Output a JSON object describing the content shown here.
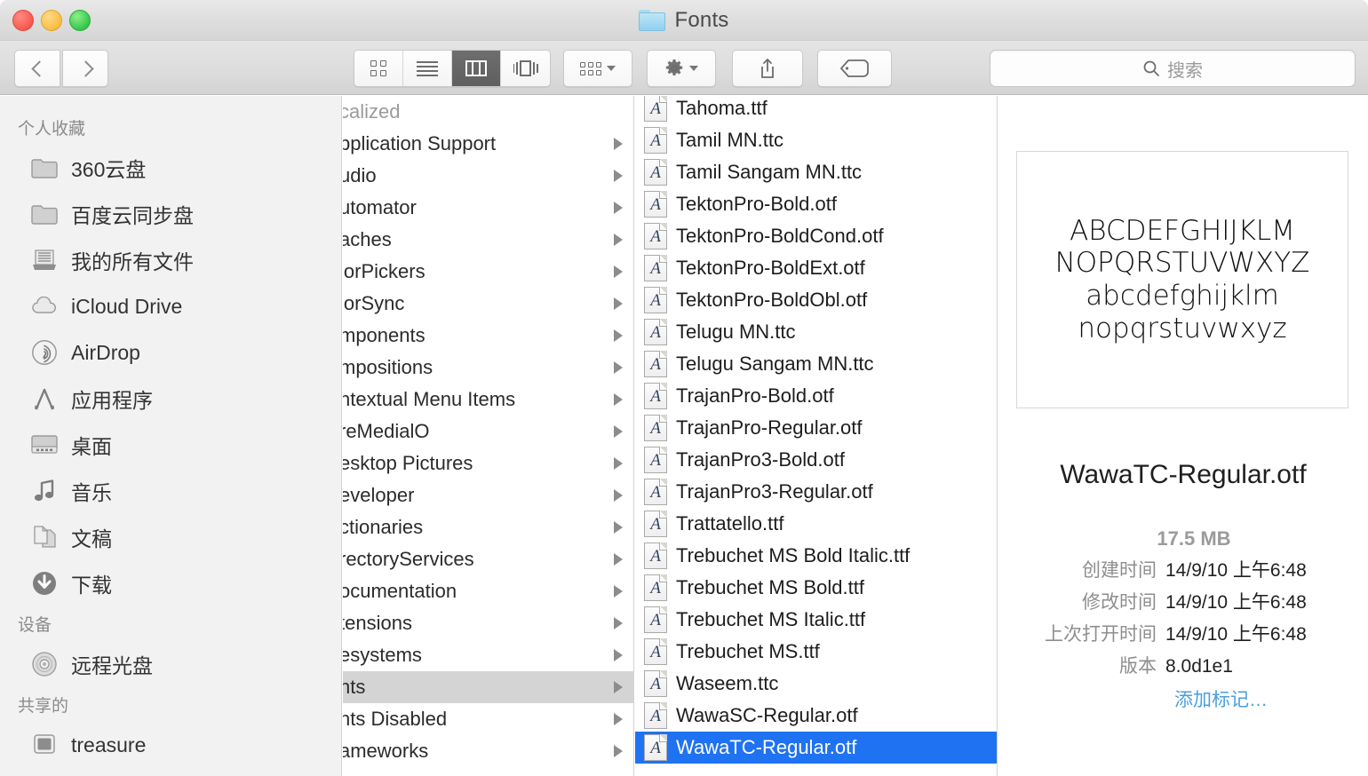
{
  "window": {
    "title": "Fonts",
    "folder_icon": "folder-icon",
    "traffic_lights": [
      "close",
      "minimize",
      "zoom"
    ]
  },
  "toolbar": {
    "back_label": "‹",
    "forward_label": "›",
    "view_modes": [
      {
        "name": "icon-view",
        "icon": "grid-icon",
        "active": false
      },
      {
        "name": "list-view",
        "icon": "list-icon",
        "active": false
      },
      {
        "name": "column-view",
        "icon": "columns-icon",
        "active": true
      },
      {
        "name": "coverflow-view",
        "icon": "coverflow-icon",
        "active": false
      }
    ],
    "arrange_icon": "arrange-icon",
    "action_icon": "gear-icon",
    "share_icon": "share-icon",
    "tag_icon": "tag-icon"
  },
  "search": {
    "placeholder": "搜索",
    "icon": "search-icon",
    "value": ""
  },
  "sidebar": {
    "sections": [
      {
        "header": "个人收藏",
        "items": [
          {
            "label": "360云盘",
            "icon": "folder-icon"
          },
          {
            "label": "百度云同步盘",
            "icon": "folder-icon"
          },
          {
            "label": "我的所有文件",
            "icon": "all-files-icon"
          },
          {
            "label": "iCloud Drive",
            "icon": "cloud-icon"
          },
          {
            "label": "AirDrop",
            "icon": "airdrop-icon"
          },
          {
            "label": "应用程序",
            "icon": "applications-icon"
          },
          {
            "label": "桌面",
            "icon": "desktop-icon"
          },
          {
            "label": "音乐",
            "icon": "music-icon"
          },
          {
            "label": "文稿",
            "icon": "documents-icon"
          },
          {
            "label": "下载",
            "icon": "downloads-icon"
          }
        ]
      },
      {
        "header": "设备",
        "items": [
          {
            "label": "远程光盘",
            "icon": "disc-icon"
          }
        ]
      },
      {
        "header": "共享的",
        "items": [
          {
            "label": "treasure",
            "icon": "computer-icon"
          }
        ]
      }
    ]
  },
  "column1": {
    "note": "names are left-clipped by the window edge as shown",
    "rows": [
      {
        "label": "calized",
        "dimmed": true,
        "has_disclosure": false,
        "selected": false
      },
      {
        "label": "pplication Support",
        "dimmed": false,
        "has_disclosure": true,
        "selected": false
      },
      {
        "label": "udio",
        "dimmed": false,
        "has_disclosure": true,
        "selected": false
      },
      {
        "label": "utomator",
        "dimmed": false,
        "has_disclosure": true,
        "selected": false
      },
      {
        "label": "aches",
        "dimmed": false,
        "has_disclosure": true,
        "selected": false
      },
      {
        "label": "lorPickers",
        "dimmed": false,
        "has_disclosure": true,
        "selected": false
      },
      {
        "label": "lorSync",
        "dimmed": false,
        "has_disclosure": true,
        "selected": false
      },
      {
        "label": "mponents",
        "dimmed": false,
        "has_disclosure": true,
        "selected": false
      },
      {
        "label": "mpositions",
        "dimmed": false,
        "has_disclosure": true,
        "selected": false
      },
      {
        "label": "ntextual Menu Items",
        "dimmed": false,
        "has_disclosure": true,
        "selected": false
      },
      {
        "label": "reMedialO",
        "dimmed": false,
        "has_disclosure": true,
        "selected": false
      },
      {
        "label": "esktop Pictures",
        "dimmed": false,
        "has_disclosure": true,
        "selected": false
      },
      {
        "label": "eveloper",
        "dimmed": false,
        "has_disclosure": true,
        "selected": false
      },
      {
        "label": "ctionaries",
        "dimmed": false,
        "has_disclosure": true,
        "selected": false
      },
      {
        "label": "rectoryServices",
        "dimmed": false,
        "has_disclosure": true,
        "selected": false
      },
      {
        "label": "ocumentation",
        "dimmed": false,
        "has_disclosure": true,
        "selected": false
      },
      {
        "label": "tensions",
        "dimmed": false,
        "has_disclosure": true,
        "selected": false
      },
      {
        "label": "esystems",
        "dimmed": false,
        "has_disclosure": true,
        "selected": false
      },
      {
        "label": "nts",
        "dimmed": false,
        "has_disclosure": true,
        "selected": true
      },
      {
        "label": "nts Disabled",
        "dimmed": false,
        "has_disclosure": true,
        "selected": false
      },
      {
        "label": "ameworks",
        "dimmed": false,
        "has_disclosure": true,
        "selected": false
      }
    ]
  },
  "column2": {
    "rows": [
      {
        "label": "Tahoma.ttf",
        "icon": "font-file-icon",
        "selected": false
      },
      {
        "label": "Tamil MN.ttc",
        "icon": "font-file-icon",
        "selected": false
      },
      {
        "label": "Tamil Sangam MN.ttc",
        "icon": "font-file-icon",
        "selected": false
      },
      {
        "label": "TektonPro-Bold.otf",
        "icon": "font-file-icon",
        "selected": false
      },
      {
        "label": "TektonPro-BoldCond.otf",
        "icon": "font-file-icon",
        "selected": false
      },
      {
        "label": "TektonPro-BoldExt.otf",
        "icon": "font-file-icon",
        "selected": false
      },
      {
        "label": "TektonPro-BoldObl.otf",
        "icon": "font-file-icon",
        "selected": false
      },
      {
        "label": "Telugu MN.ttc",
        "icon": "font-file-icon",
        "selected": false
      },
      {
        "label": "Telugu Sangam MN.ttc",
        "icon": "font-file-icon",
        "selected": false
      },
      {
        "label": "TrajanPro-Bold.otf",
        "icon": "font-file-icon",
        "selected": false
      },
      {
        "label": "TrajanPro-Regular.otf",
        "icon": "font-file-icon",
        "selected": false
      },
      {
        "label": "TrajanPro3-Bold.otf",
        "icon": "font-file-icon",
        "selected": false
      },
      {
        "label": "TrajanPro3-Regular.otf",
        "icon": "font-file-icon",
        "selected": false
      },
      {
        "label": "Trattatello.ttf",
        "icon": "font-file-icon",
        "selected": false
      },
      {
        "label": "Trebuchet MS Bold Italic.ttf",
        "icon": "font-file-icon",
        "selected": false
      },
      {
        "label": "Trebuchet MS Bold.ttf",
        "icon": "font-file-icon",
        "selected": false
      },
      {
        "label": "Trebuchet MS Italic.ttf",
        "icon": "font-file-icon",
        "selected": false
      },
      {
        "label": "Trebuchet MS.ttf",
        "icon": "font-file-icon",
        "selected": false
      },
      {
        "label": "Waseem.ttc",
        "icon": "font-file-icon",
        "selected": false
      },
      {
        "label": "WawaSC-Regular.otf",
        "icon": "font-file-icon",
        "selected": false
      },
      {
        "label": "WawaTC-Regular.otf",
        "icon": "font-file-icon",
        "selected": true
      }
    ]
  },
  "preview": {
    "sample_lines": [
      "ABCDEFGHIJKLM",
      "NOPQRSTUVWXYZ",
      "abcdefghijklm",
      "nopqrstuvwxyz"
    ],
    "filename": "WawaTC-Regular.otf",
    "size": "17.5 MB",
    "metadata": [
      {
        "key": "创建时间",
        "value": "14/9/10 上午6:48"
      },
      {
        "key": "修改时间",
        "value": "14/9/10 上午6:48"
      },
      {
        "key": "上次打开时间",
        "value": "14/9/10 上午6:48"
      },
      {
        "key": "版本",
        "value": "8.0d1e1"
      }
    ],
    "add_tags_label": "添加标记…"
  },
  "colors": {
    "selection_blue": "#1f72f2",
    "selection_gray": "#d4d4d4",
    "link_blue": "#4a9fe0",
    "sidebar_bg": "#f2f2f2",
    "toolbar_bg": "#dcdcdc"
  }
}
